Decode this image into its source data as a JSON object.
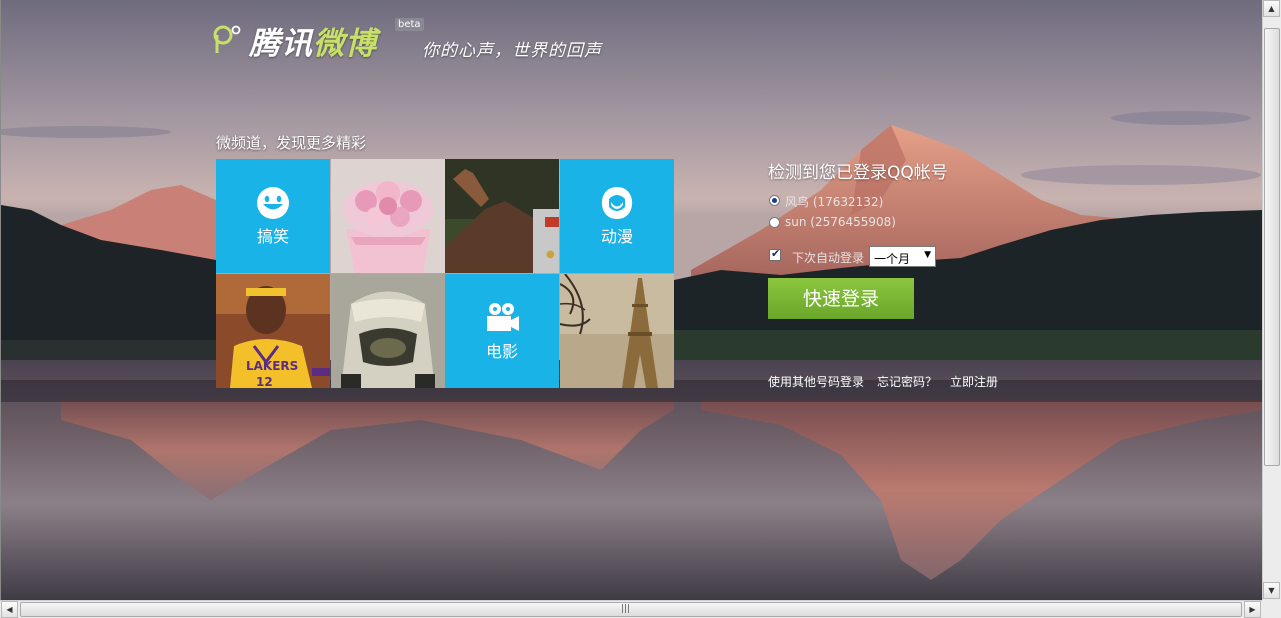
{
  "brand": {
    "name_part1": "腾讯",
    "name_part2": "微博",
    "beta": "beta",
    "slogan": "你的心声，世界的回声"
  },
  "channels": {
    "title": "微频道，发现更多精彩",
    "tiles": [
      {
        "label": "搞笑",
        "icon": "smiley-icon"
      },
      {
        "label": "",
        "image": "cupcake-photo"
      },
      {
        "label": "",
        "image": "athlete-arm-photo"
      },
      {
        "label": "动漫",
        "icon": "anime-character-icon"
      },
      {
        "label": "",
        "image": "basketball-player-photo"
      },
      {
        "label": "",
        "image": "silver-car-photo"
      },
      {
        "label": "电影",
        "icon": "movie-camera-icon"
      },
      {
        "label": "",
        "image": "eiffel-tower-photo"
      }
    ]
  },
  "login": {
    "title": "检测到您已登录QQ帐号",
    "accounts": [
      {
        "text": "风鸟 (17632132)",
        "checked": true
      },
      {
        "text": "sun (2576455908)",
        "checked": false
      }
    ],
    "auto_login_label": "下次自动登录",
    "auto_login_checked": true,
    "duration": "一个月",
    "submit": "快速登录",
    "links": {
      "other_account": "使用其他号码登录",
      "forgot": "忘记密码？",
      "register": "立即注册"
    }
  },
  "colors": {
    "tile_blue": "#1ab3e8",
    "login_green": "#7ab834"
  }
}
